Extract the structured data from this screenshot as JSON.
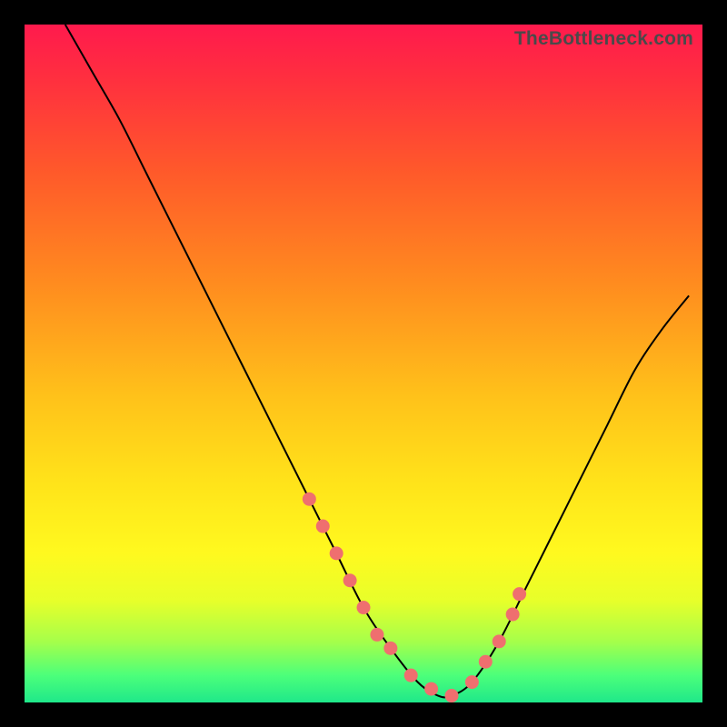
{
  "watermark": "TheBottleneck.com",
  "colors": {
    "background": "#000000",
    "gradient_top": "#ff1a4d",
    "gradient_bottom": "#1fe88a",
    "curve": "#000000",
    "dots": "#ef6f6f"
  },
  "chart_data": {
    "type": "line",
    "title": "",
    "xlabel": "",
    "ylabel": "",
    "xlim": [
      0,
      100
    ],
    "ylim": [
      0,
      100
    ],
    "grid": false,
    "series": [
      {
        "name": "bottleneck-curve",
        "x": [
          6,
          10,
          14,
          18,
          22,
          26,
          30,
          34,
          38,
          42,
          46,
          50,
          54,
          58,
          61,
          63,
          66,
          70,
          74,
          78,
          82,
          86,
          90,
          94,
          98
        ],
        "y": [
          100,
          93,
          86,
          78,
          70,
          62,
          54,
          46,
          38,
          30,
          22,
          14,
          8,
          3,
          1,
          1,
          3,
          9,
          17,
          25,
          33,
          41,
          49,
          55,
          60
        ]
      }
    ],
    "markers": {
      "name": "highlighted-points",
      "x": [
        42,
        44,
        46,
        48,
        50,
        52,
        54,
        57,
        60,
        63,
        66,
        68,
        70,
        72,
        73
      ],
      "y": [
        30,
        26,
        22,
        18,
        14,
        10,
        8,
        4,
        2,
        1,
        3,
        6,
        9,
        13,
        16
      ]
    }
  }
}
